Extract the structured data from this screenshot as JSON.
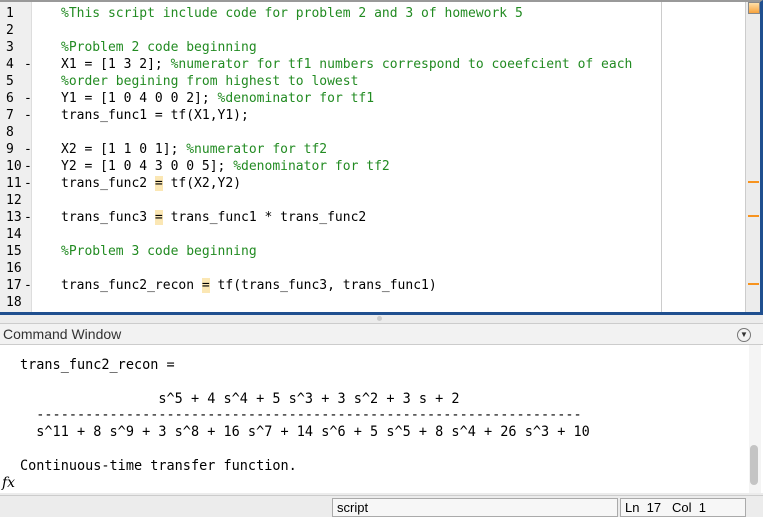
{
  "editor": {
    "lines": [
      {
        "n": "1",
        "dash": "",
        "parts": [
          {
            "t": "%This script include code for problem 2 and 3 of homework 5",
            "c": "cm"
          }
        ]
      },
      {
        "n": "2",
        "dash": "",
        "parts": []
      },
      {
        "n": "3",
        "dash": "",
        "parts": [
          {
            "t": "%Problem 2 code beginning",
            "c": "cm"
          }
        ]
      },
      {
        "n": "4",
        "dash": "-",
        "parts": [
          {
            "t": "X1 = [1 3 2]; ",
            "c": ""
          },
          {
            "t": "%numerator for tf1 numbers correspond to coeefcient of each",
            "c": "cm"
          }
        ]
      },
      {
        "n": "5",
        "dash": "",
        "parts": [
          {
            "t": "%order begining from highest to lowest",
            "c": "cm"
          }
        ]
      },
      {
        "n": "6",
        "dash": "-",
        "parts": [
          {
            "t": "Y1 = [1 0 4 0 0 2]; ",
            "c": ""
          },
          {
            "t": "%denominator for tf1",
            "c": "cm"
          }
        ]
      },
      {
        "n": "7",
        "dash": "-",
        "parts": [
          {
            "t": "trans_func1 = tf(X1,Y1);",
            "c": ""
          }
        ]
      },
      {
        "n": "8",
        "dash": "",
        "parts": []
      },
      {
        "n": "9",
        "dash": "-",
        "parts": [
          {
            "t": "X2 = [1 1 0 1]; ",
            "c": ""
          },
          {
            "t": "%numerator for tf2",
            "c": "cm"
          }
        ]
      },
      {
        "n": "10",
        "dash": "-",
        "parts": [
          {
            "t": "Y2 = [1 0 4 3 0 0 5]; ",
            "c": ""
          },
          {
            "t": "%denominator for tf2",
            "c": "cm"
          }
        ]
      },
      {
        "n": "11",
        "dash": "-",
        "parts": [
          {
            "t": "trans_func2 ",
            "c": ""
          },
          {
            "t": "=",
            "c": "hl"
          },
          {
            "t": " tf(X2,Y2)",
            "c": ""
          }
        ]
      },
      {
        "n": "12",
        "dash": "",
        "parts": []
      },
      {
        "n": "13",
        "dash": "-",
        "parts": [
          {
            "t": "trans_func3 ",
            "c": ""
          },
          {
            "t": "=",
            "c": "hl"
          },
          {
            "t": " trans_func1 * trans_func2",
            "c": ""
          }
        ]
      },
      {
        "n": "14",
        "dash": "",
        "parts": []
      },
      {
        "n": "15",
        "dash": "",
        "parts": [
          {
            "t": "%Problem 3 code beginning",
            "c": "cm"
          }
        ]
      },
      {
        "n": "16",
        "dash": "",
        "parts": []
      },
      {
        "n": "17",
        "dash": "-",
        "parts": [
          {
            "t": "trans_func2_recon ",
            "c": ""
          },
          {
            "t": "=",
            "c": "hl"
          },
          {
            "t": " tf(trans_func3, trans_func1)",
            "c": ""
          }
        ]
      },
      {
        "n": "18",
        "dash": "",
        "parts": []
      }
    ]
  },
  "command_window": {
    "title": "Command Window",
    "output": [
      "trans_func2_recon =",
      "",
      "                 s^5 + 4 s^4 + 5 s^3 + 3 s^2 + 3 s + 2",
      "  -------------------------------------------------------------------",
      "  s^11 + 8 s^9 + 3 s^8 + 16 s^7 + 14 s^6 + 5 s^5 + 8 s^4 + 26 s^3 + 10",
      "",
      "Continuous-time transfer function."
    ],
    "prompt_icon": "fx"
  },
  "status": {
    "mode": "script",
    "position": "Ln  17   Col  1"
  }
}
